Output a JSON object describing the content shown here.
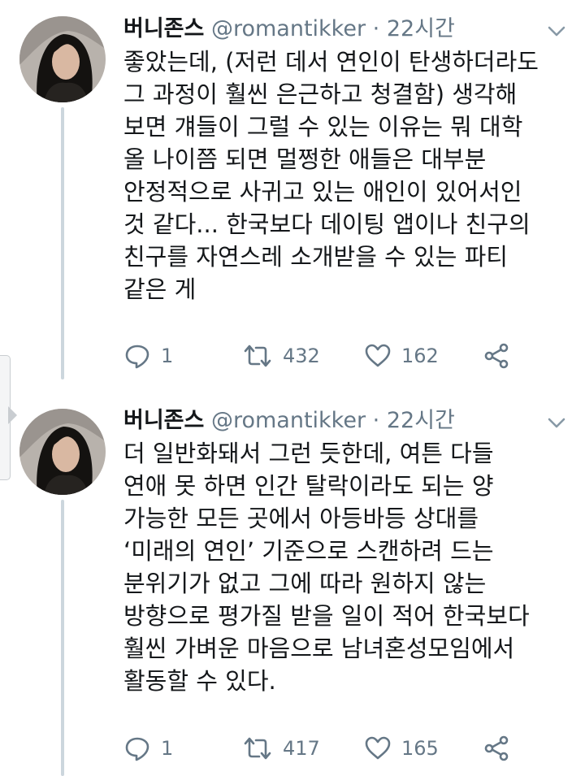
{
  "tweets": [
    {
      "display_name": "버니존스",
      "handle": "@romantikker",
      "separator": "·",
      "time": "22시간",
      "lines": [
        "좋았는데, (저런 데서 연인이 탄생하더라도",
        "그 과정이 훨씬 은근하고 청결함) 생각해",
        "보면 걔들이 그럴 수 있는 이유는 뭐 대학",
        "올 나이쯤 되면 멀쩡한 애들은 대부분",
        "안정적으로 사귀고 있는 애인이 있어서인",
        "것 같다... 한국보다 데이팅 앱이나 친구의",
        "친구를 자연스레 소개받을 수 있는 파티",
        "같은 게"
      ],
      "replies": "1",
      "retweets": "432",
      "likes": "162"
    },
    {
      "display_name": "버니존스",
      "handle": "@romantikker",
      "separator": "·",
      "time": "22시간",
      "lines": [
        "더 일반화돼서 그런 듯한데, 여튼 다들",
        "연애 못 하면 인간 탈락이라도 되는 양",
        "가능한 모든 곳에서 아등바등 상대를",
        "‘미래의 연인’ 기준으로 스캔하려 드는",
        "분위기가 없고 그에 따라 원하지 않는",
        "방향으로 평가질 받을 일이 적어 한국보다",
        "훨씬 가벼운 마음으로 남녀혼성모임에서",
        "활동할 수 있다."
      ],
      "replies": "1",
      "retweets": "417",
      "likes": "165"
    }
  ],
  "icons": [
    "avatar",
    "chevron-down-icon",
    "reply-icon",
    "retweet-icon",
    "like-icon",
    "share-icon"
  ],
  "colors": {
    "text": "#14171a",
    "secondary": "#657786",
    "thread_line": "#ccd6dd"
  }
}
